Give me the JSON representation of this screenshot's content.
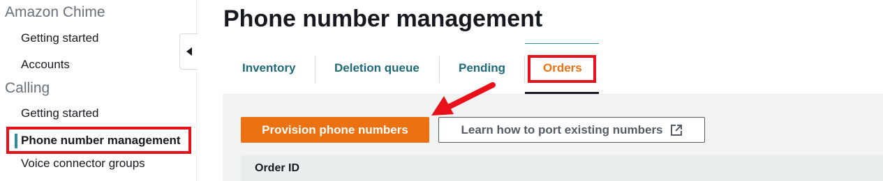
{
  "sidebar": {
    "sections": [
      {
        "title": "Amazon Chime",
        "items": [
          {
            "label": "Getting started"
          },
          {
            "label": "Accounts"
          }
        ]
      },
      {
        "title": "Calling",
        "items": [
          {
            "label": "Getting started"
          },
          {
            "label": "Phone number management",
            "active": true
          },
          {
            "label": "Voice connector groups"
          }
        ]
      }
    ],
    "collapse_icon": "caret-left-icon"
  },
  "page": {
    "title": "Phone number management"
  },
  "tabs": [
    {
      "label": "Inventory"
    },
    {
      "label": "Deletion queue"
    },
    {
      "label": "Pending"
    },
    {
      "label": "Orders",
      "active": true
    }
  ],
  "actions": {
    "primary_label": "Provision phone numbers",
    "secondary_label": "Learn how to port existing numbers",
    "secondary_icon": "external-link-icon"
  },
  "table": {
    "columns": [
      "Order ID"
    ]
  },
  "colors": {
    "accent_orange": "#ec7211",
    "tab_teal": "#1d6a78",
    "highlight_red": "#e8101a",
    "active_bar": "#2e8b9a"
  }
}
